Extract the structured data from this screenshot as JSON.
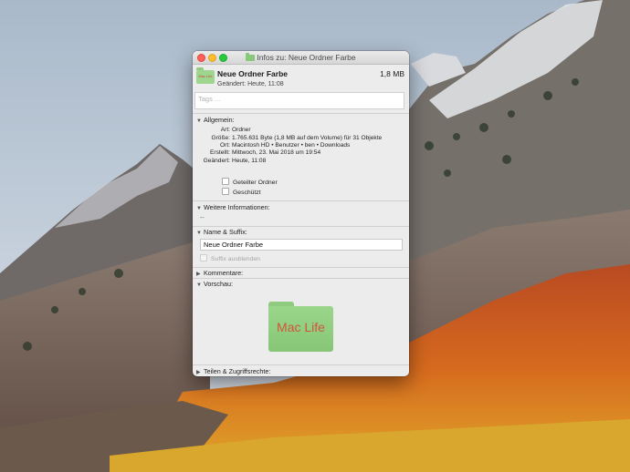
{
  "window": {
    "title": "Infos zu: Neue Ordner Farbe"
  },
  "header": {
    "name": "Neue Ordner Farbe",
    "size": "1,8 MB",
    "modified": "Geändert: Heute, 11:08",
    "icon_label": "Mac Life"
  },
  "tags": {
    "placeholder": "Tags ..."
  },
  "general": {
    "title": "Allgemein:",
    "rows": [
      {
        "key": "Art:",
        "value": "Ordner"
      },
      {
        "key": "Größe:",
        "value": "1.765.631 Byte (1,8 MB auf dem Volume) für 31 Objekte"
      },
      {
        "key": "Ort:",
        "value": "Macintosh HD • Benutzer • ben • Downloads"
      },
      {
        "key": "Erstellt:",
        "value": "Mittwoch, 23. Mai 2018 um 19:54"
      },
      {
        "key": "Geändert:",
        "value": "Heute, 11:08"
      }
    ],
    "shared_folder": "Geteilter Ordner",
    "locked": "Geschützt"
  },
  "more_info": {
    "title": "Weitere Informationen:",
    "value": "--"
  },
  "name_suffix": {
    "title": "Name & Suffix:",
    "value": "Neue Ordner Farbe",
    "hide_suffix": "Suffix ausblenden"
  },
  "comments": {
    "title": "Kommentare:"
  },
  "preview": {
    "title": "Vorschau:",
    "label": "Mac Life"
  },
  "sharing": {
    "title": "Teilen & Zugriffsrechte:"
  },
  "colors": {
    "folder_green": "#9ad68a",
    "folder_text": "#d3543e"
  }
}
